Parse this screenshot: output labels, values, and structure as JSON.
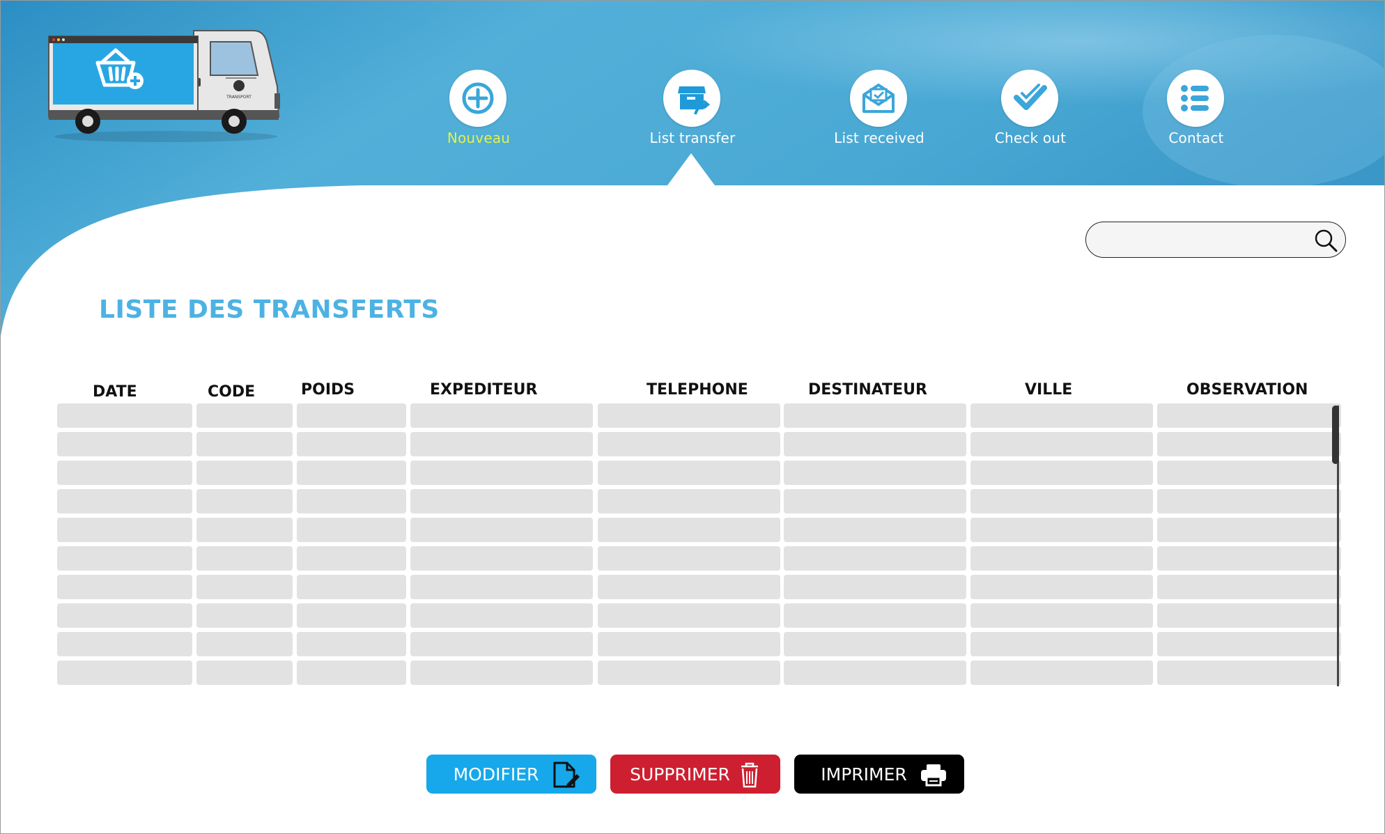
{
  "colors": {
    "header_blue": "#4aa9d4",
    "accent_blue": "#4db2e3",
    "nav_active_label": "#e2f24a",
    "cell_gray": "#e2e2e2",
    "btn_modifier": "#16a8ea",
    "btn_supprimer": "#cd1f30",
    "btn_imprimer": "#000000"
  },
  "logo": {
    "icon": "delivery-truck-logo",
    "text": "TRANSPORT"
  },
  "nav": {
    "items": [
      {
        "label": "Nouveau",
        "icon": "add-circle-icon",
        "highlighted": true
      },
      {
        "label": "List transfer",
        "icon": "box-transfer-icon",
        "selected": true
      },
      {
        "label": "List received",
        "icon": "mail-check-icon"
      },
      {
        "label": "Check out",
        "icon": "double-check-icon"
      },
      {
        "label": "Contact",
        "icon": "list-icon"
      }
    ]
  },
  "search": {
    "value": "",
    "placeholder": "",
    "icon": "search-icon"
  },
  "page": {
    "title": "LISTE DES TRANSFERTS"
  },
  "table": {
    "columns": [
      "DATE",
      "CODE",
      "POIDS",
      "EXPEDITEUR",
      "TELEPHONE",
      "DESTINATEUR",
      "VILLE",
      "OBSERVATION"
    ],
    "row_count": 10,
    "rows": []
  },
  "actions": {
    "modifier": {
      "label": "MODIFIER",
      "icon": "edit-document-icon"
    },
    "supprimer": {
      "label": "SUPPRIMER",
      "icon": "trash-icon"
    },
    "imprimer": {
      "label": "IMPRIMER",
      "icon": "printer-icon"
    }
  }
}
